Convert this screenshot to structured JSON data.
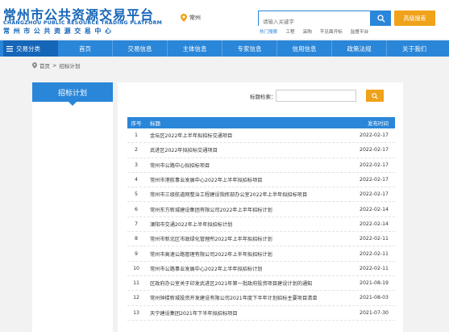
{
  "header": {
    "logo_cn": "常州市公共资源交易平台",
    "logo_en": "CHANGZHOU PUBLIC RESOURCE TRADING PLATFORM",
    "logo_cn2": "常州市公共资源交易中心",
    "location": "常州",
    "search_placeholder": "请输入关键字",
    "advanced_search": "高级搜索",
    "quick_links": [
      "热门搜索",
      "工程",
      "采购",
      "不见面开标",
      "监督平台"
    ]
  },
  "nav": {
    "category_label": "交易分类",
    "items": [
      "首页",
      "交易信息",
      "主体信息",
      "专家信息",
      "信用信息",
      "政策法规",
      "关于我们"
    ]
  },
  "breadcrumb": {
    "home": "首页",
    "separator": ">",
    "current": "招标计划"
  },
  "sidebar": {
    "title": "招标计划"
  },
  "filter": {
    "label": "标题检索：",
    "value": ""
  },
  "table": {
    "headers": {
      "no": "序号",
      "title": "标题",
      "date": "发布时间"
    },
    "rows": [
      {
        "no": "1",
        "title": "金坛区2022年上半年拟招标交通项目",
        "date": "2022-02-17"
      },
      {
        "no": "2",
        "title": "武进区2022年拟招标交通项目",
        "date": "2022-02-17"
      },
      {
        "no": "3",
        "title": "常州市公路中心拟招标项目",
        "date": "2022-02-17"
      },
      {
        "no": "4",
        "title": "常州市港航事业发展中心2022年上半年拟招标项目",
        "date": "2022-02-17"
      },
      {
        "no": "5",
        "title": "常州市三级航道网整治工程建设指挥部办公室2022年上半年拟招标项目",
        "date": "2022-02-17"
      },
      {
        "no": "6",
        "title": "常州东方新城建设集团有限公司2022年上半年招标计划",
        "date": "2022-02-14"
      },
      {
        "no": "7",
        "title": "溧阳市交通2022年上半年拟招标计划",
        "date": "2022-02-14"
      },
      {
        "no": "8",
        "title": "常州市新北区市政绿化管理所2022年上半年拟招标计划",
        "date": "2022-02-11"
      },
      {
        "no": "9",
        "title": "常州市高速公路管理有限公司2022年上半年拟招标计划",
        "date": "2022-02-11"
      },
      {
        "no": "10",
        "title": "常州市公路事业发展中心2022年上半年拟招标计划",
        "date": "2022-02-11"
      },
      {
        "no": "11",
        "title": "区政府办公室关于印发武进区2021年第一批政府投资项目建设计划的通知",
        "date": "2021-08-19"
      },
      {
        "no": "12",
        "title": "常州钟楼新城投资开发建设有限公司2021年度下半年计划招标主要项目清单",
        "date": "2021-08-03"
      },
      {
        "no": "13",
        "title": "天宁建设集团2021年下半年拟招标项目",
        "date": "2021-07-30"
      }
    ]
  },
  "colors": {
    "primary": "#2a86d8",
    "dark_blue": "#1565b8",
    "orange": "#f0a21b"
  }
}
